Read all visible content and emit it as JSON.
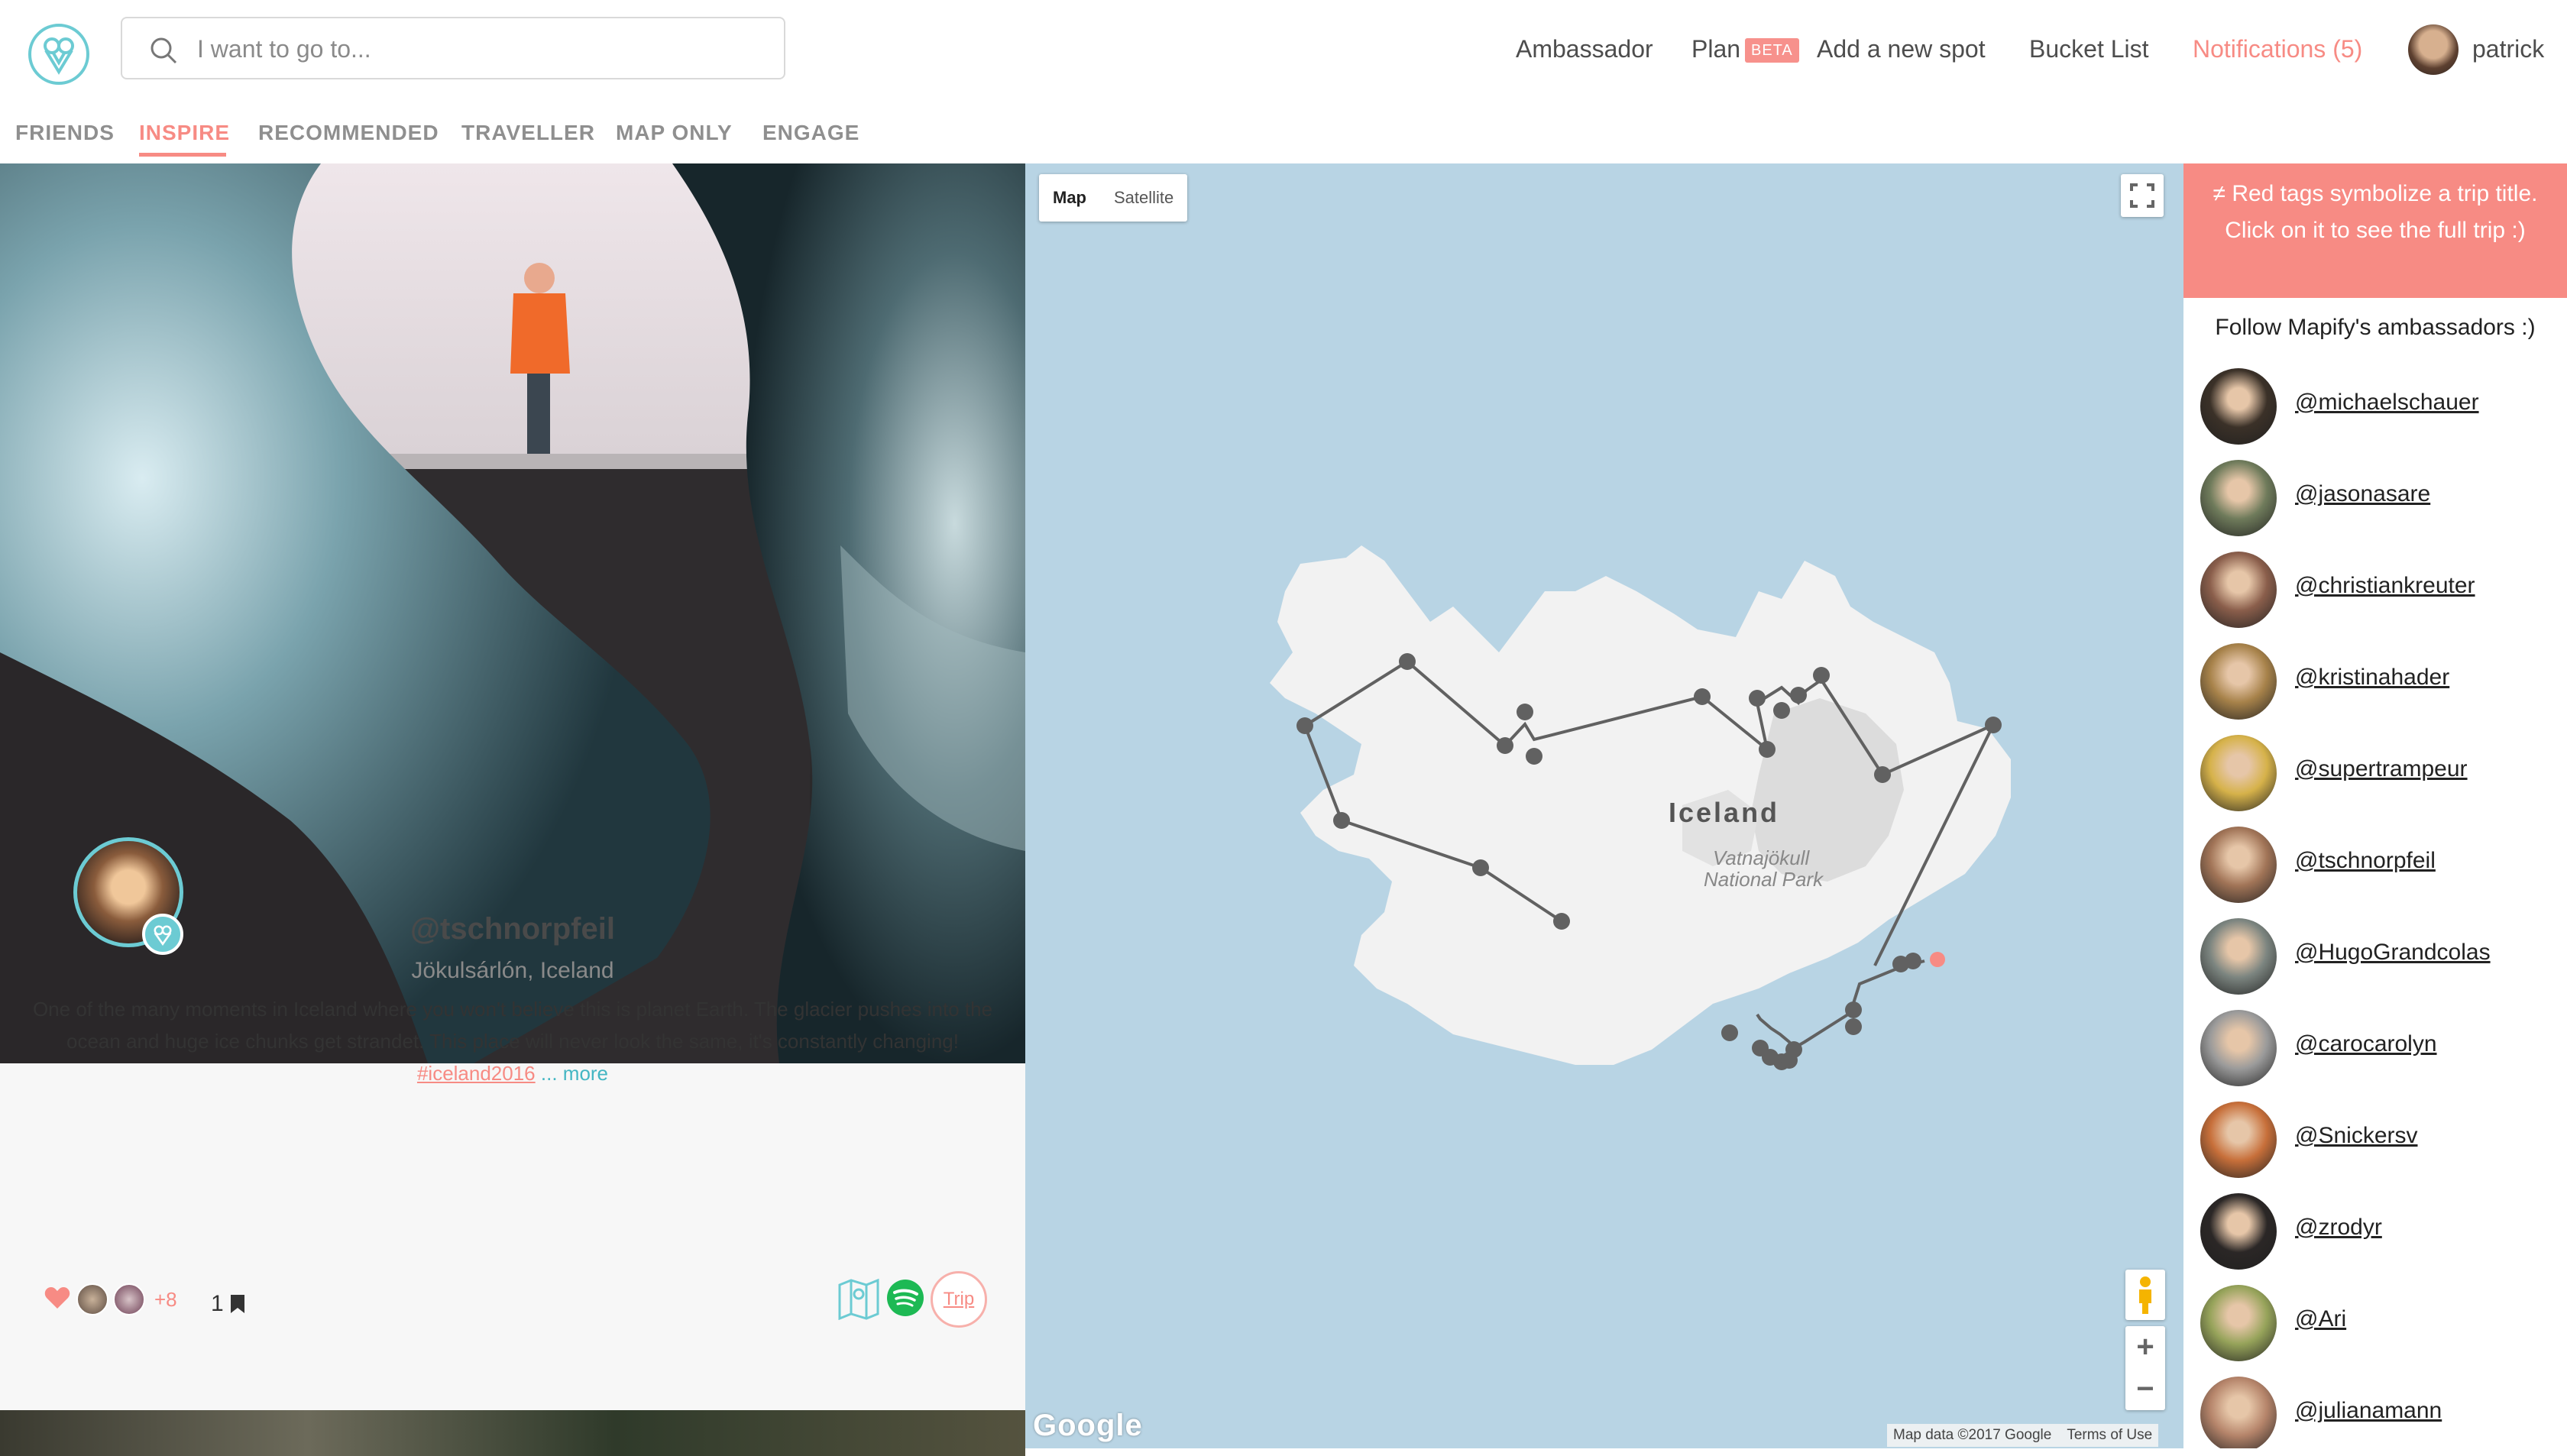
{
  "header": {
    "search_placeholder": "I want to go to...",
    "nav": {
      "ambassador": "Ambassador",
      "plan": "Plan",
      "plan_badge": "BETA",
      "add_spot": "Add a new spot",
      "bucket_list": "Bucket List",
      "notifications": "Notifications (5)",
      "username": "patrick"
    },
    "tabs": [
      "FRIENDS",
      "INSPIRE",
      "RECOMMENDED",
      "TRAVELLER",
      "MAP ONLY",
      "ENGAGE"
    ],
    "active_tab": "INSPIRE"
  },
  "post": {
    "username": "@tschnorpfeil",
    "location": "Jökulsárlón, Iceland",
    "caption": "One of the many moments in Iceland where you won't believe this is planet Earth. The glacier pushes into the ocean and huge ice chunks get strandet. This place will never look the same, it's constantly changing!",
    "hashtag": "#iceland2016",
    "more_label": "... more",
    "likers_more": "+8",
    "saves": "1",
    "trip_label": "Trip"
  },
  "map": {
    "type_map": "Map",
    "type_satellite": "Satellite",
    "country_label": "Iceland",
    "park_label_1": "Vatnajökull",
    "park_label_2": "National Park",
    "zoom_in": "+",
    "zoom_out": "−",
    "google": "Google",
    "map_data": "Map data ©2017 Google",
    "terms": "Terms of Use"
  },
  "sidebar": {
    "notice": "Red tags symbolize a trip title. Click on it to see the full trip :)",
    "follow_title": "Follow Mapify's ambassadors :)",
    "ambassadors": [
      {
        "name": "@michaelschauer",
        "color": "#3b3128"
      },
      {
        "name": "@jasonasare",
        "color": "#6f7b5b"
      },
      {
        "name": "@christiankreuter",
        "color": "#8a5e4b"
      },
      {
        "name": "@kristinahader",
        "color": "#a7824a"
      },
      {
        "name": "@supertrampeur",
        "color": "#d6b24a"
      },
      {
        "name": "@tschnorpfeil",
        "color": "#a17457"
      },
      {
        "name": "@HugoGrandcolas",
        "color": "#7c8580"
      },
      {
        "name": "@carocarolyn",
        "color": "#9a9a9a"
      },
      {
        "name": "@Snickersv",
        "color": "#c76f3a"
      },
      {
        "name": "@zrodyr",
        "color": "#2b2726"
      },
      {
        "name": "@Ari",
        "color": "#96a35a"
      },
      {
        "name": "@julianamann",
        "color": "#b5846a"
      }
    ]
  },
  "colors": {
    "accent": "#f78b84",
    "teal": "#6ccbd3",
    "ocean": "#b8d4e4",
    "land": "#f2f2f2",
    "route": "#616161"
  }
}
